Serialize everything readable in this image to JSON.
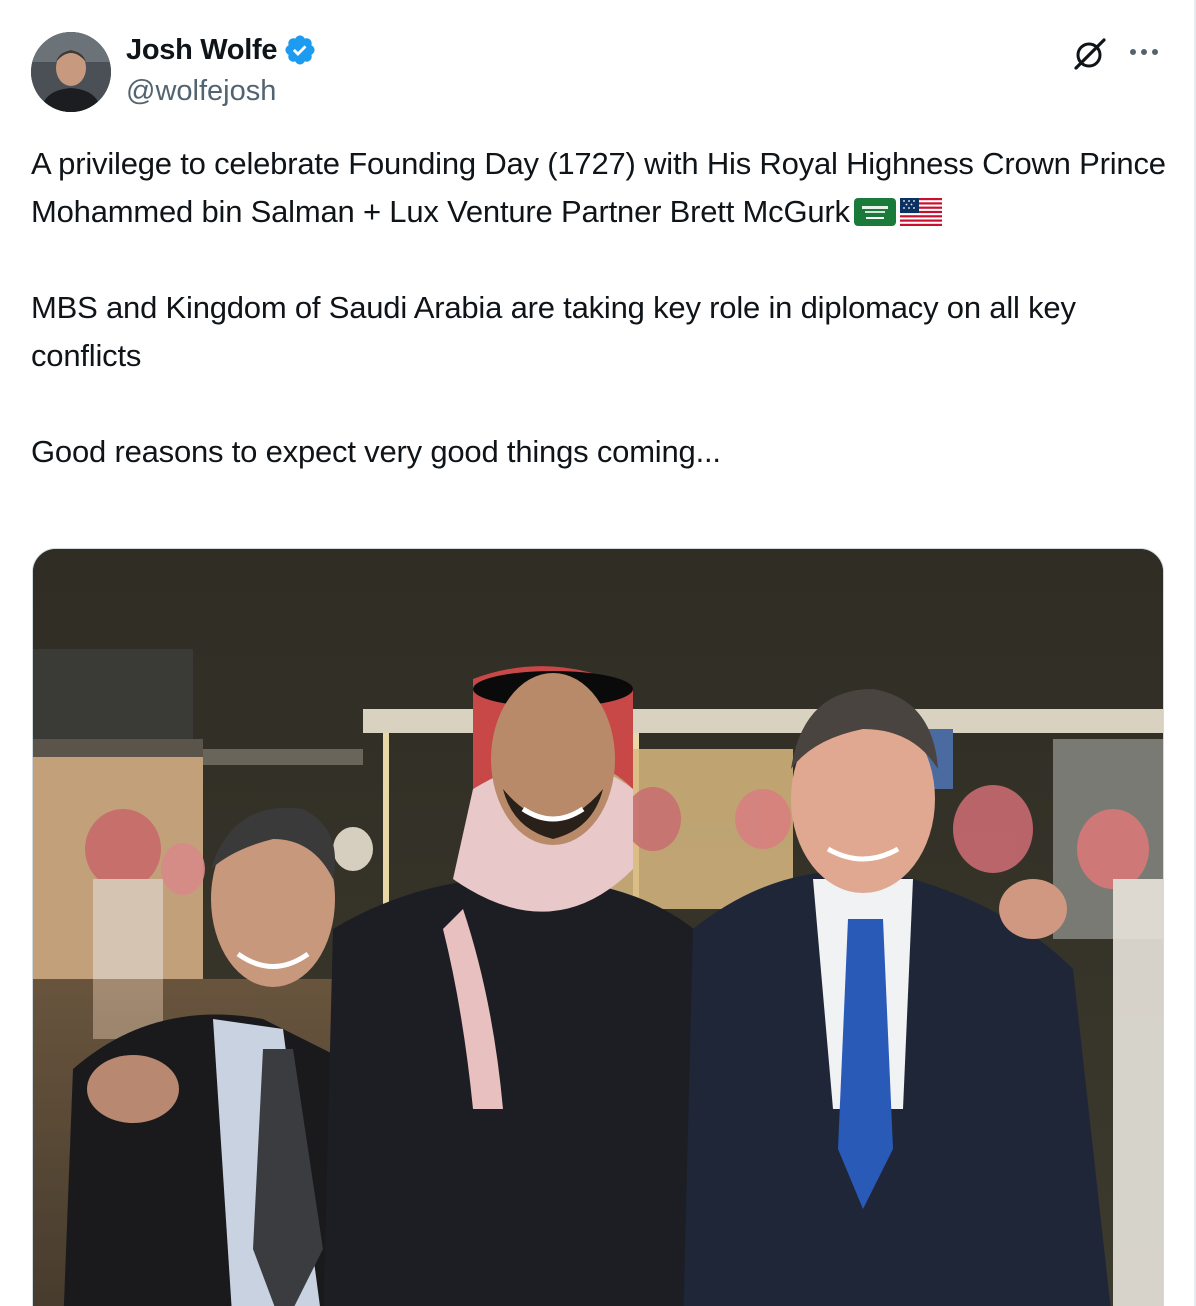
{
  "author": {
    "display_name": "Josh Wolfe",
    "handle": "@wolfejosh",
    "verified": true,
    "verified_badge_color": "#1d9bf0"
  },
  "actions": {
    "grok_icon": "grok-icon",
    "more_icon": "more-icon"
  },
  "tweet": {
    "paragraphs": [
      "A privilege to celebrate Founding Day (1727) with His Royal Highness Crown Prince Mohammed bin Salman + Lux Venture Partner Brett McGurk",
      "MBS and Kingdom of Saudi Arabia are taking key role in diplomacy on all key conflicts",
      "Good reasons to expect very good things coming..."
    ],
    "emojis": [
      "flag-saudi-arabia",
      "flag-united-states"
    ]
  },
  "media": {
    "type": "photo",
    "icon": "photo-image"
  },
  "colors": {
    "text_primary": "#0f1419",
    "text_secondary": "#536471",
    "border": "#cfd9de"
  }
}
